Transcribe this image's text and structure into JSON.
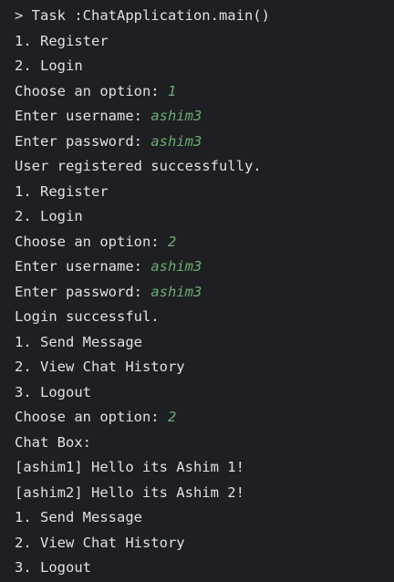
{
  "console": {
    "lines": [
      {
        "text": "> Task :ChatApplication.main()",
        "input": ""
      },
      {
        "text": "1. Register",
        "input": ""
      },
      {
        "text": "2. Login",
        "input": ""
      },
      {
        "text": "Choose an option: ",
        "input": "1"
      },
      {
        "text": "Enter username: ",
        "input": "ashim3"
      },
      {
        "text": "Enter password: ",
        "input": "ashim3"
      },
      {
        "text": "User registered successfully.",
        "input": ""
      },
      {
        "text": "1. Register",
        "input": ""
      },
      {
        "text": "2. Login",
        "input": ""
      },
      {
        "text": "Choose an option: ",
        "input": "2"
      },
      {
        "text": "Enter username: ",
        "input": "ashim3"
      },
      {
        "text": "Enter password: ",
        "input": "ashim3"
      },
      {
        "text": "Login successful.",
        "input": ""
      },
      {
        "text": "1. Send Message",
        "input": ""
      },
      {
        "text": "2. View Chat History",
        "input": ""
      },
      {
        "text": "3. Logout",
        "input": ""
      },
      {
        "text": "Choose an option: ",
        "input": "2"
      },
      {
        "text": "Chat Box:",
        "input": ""
      },
      {
        "text": "[ashim1] Hello its Ashim 1!",
        "input": ""
      },
      {
        "text": "[ashim2] Hello its Ashim 2!",
        "input": ""
      },
      {
        "text": "1. Send Message",
        "input": ""
      },
      {
        "text": "2. View Chat History",
        "input": ""
      },
      {
        "text": "3. Logout",
        "input": ""
      }
    ]
  },
  "colors": {
    "background": "#1e1f22",
    "text": "#dfe1e5",
    "user_input": "#6aab73"
  }
}
